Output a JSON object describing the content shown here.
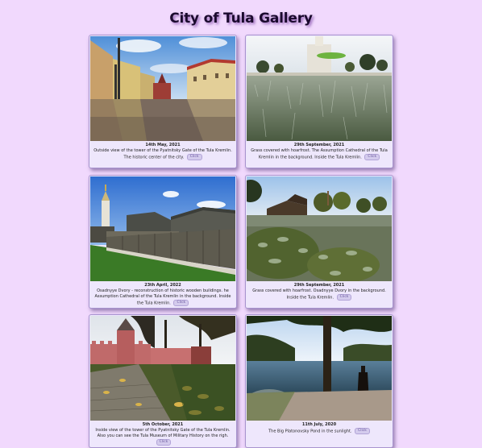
{
  "page": {
    "title": "City of Tula Gallery",
    "background": "#f1d9fd"
  },
  "gallery": [
    {
      "date": "14th May, 2021",
      "text": "Outside view of the tower of the Pyatnitsky Gate of the Tula Kremlin. The historic center of the city.",
      "button": "Click",
      "image": "kremlin-gate-street-reflection"
    },
    {
      "date": "29th September, 2021",
      "text": "Grass covered with hoarfrost. The Assumption Cathedral of the Tula Kremlin in the background. Inside the Tula Kremlin.",
      "button": "Click",
      "image": "frosty-grass-cathedral"
    },
    {
      "date": "23th April, 2022",
      "text": "Osadnyye Dvory - reconstruction of historic wooden buildings. he Assumption Cathedral of the Tula Kremlin in the background. Inside the Tula Kremlin.",
      "button": "Click",
      "image": "wooden-fence-bell-tower"
    },
    {
      "date": "29th September, 2021",
      "text": "Grass covered with hoarfrost. Osadnyye Dvory in the background. Inside the Tula Kremlin.",
      "button": "Click",
      "image": "frosty-shrubs-wooden-houses"
    },
    {
      "date": "5th October, 2021",
      "text": "Inside view of the tower of the Pyatnitsky Gate of the Tula Kremlin. Also you can see the Tula Museum of Military History on the righ.",
      "button": "Click",
      "image": "kremlin-wall-autumn-leaves"
    },
    {
      "date": "11th July, 2020",
      "text": "The Big Platonovsky Pond in the sunlight.",
      "button": "Click",
      "image": "pond-tree-sunlight"
    }
  ]
}
